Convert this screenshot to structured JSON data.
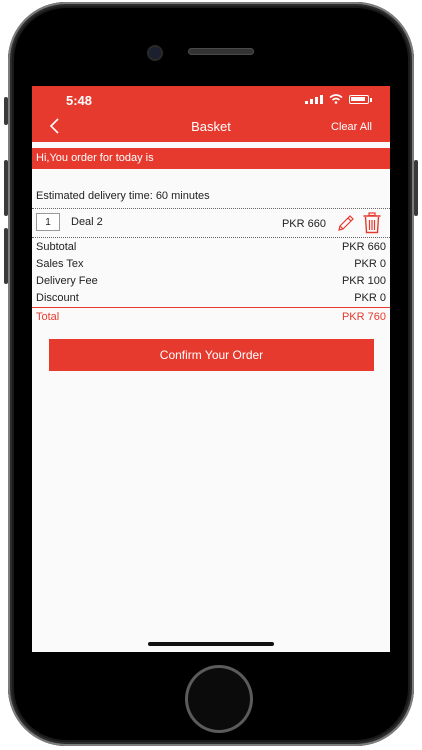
{
  "status": {
    "time": "5:48"
  },
  "header": {
    "title": "Basket",
    "clear_label": "Clear All"
  },
  "greeting": "Hi,You order for today is",
  "delivery_text": "Estimated delivery time: 60 minutes",
  "item": {
    "qty": "1",
    "name": "Deal 2",
    "price": "PKR 660"
  },
  "summary": [
    {
      "label": "Subtotal",
      "value": "PKR 660"
    },
    {
      "label": "Sales Tex",
      "value": "PKR 0"
    },
    {
      "label": "Delivery Fee",
      "value": "PKR 100"
    },
    {
      "label": "Discount",
      "value": "PKR 0"
    }
  ],
  "total": {
    "label": "Total",
    "value": "PKR 760"
  },
  "confirm_label": "Confirm Your Order",
  "colors": {
    "accent": "#e73a2e",
    "background": "#fafafa"
  },
  "icons": [
    "camera-icon",
    "back-chevron-icon",
    "signal-icon",
    "wifi-icon",
    "battery-icon",
    "edit-pencil-icon",
    "trash-icon"
  ]
}
